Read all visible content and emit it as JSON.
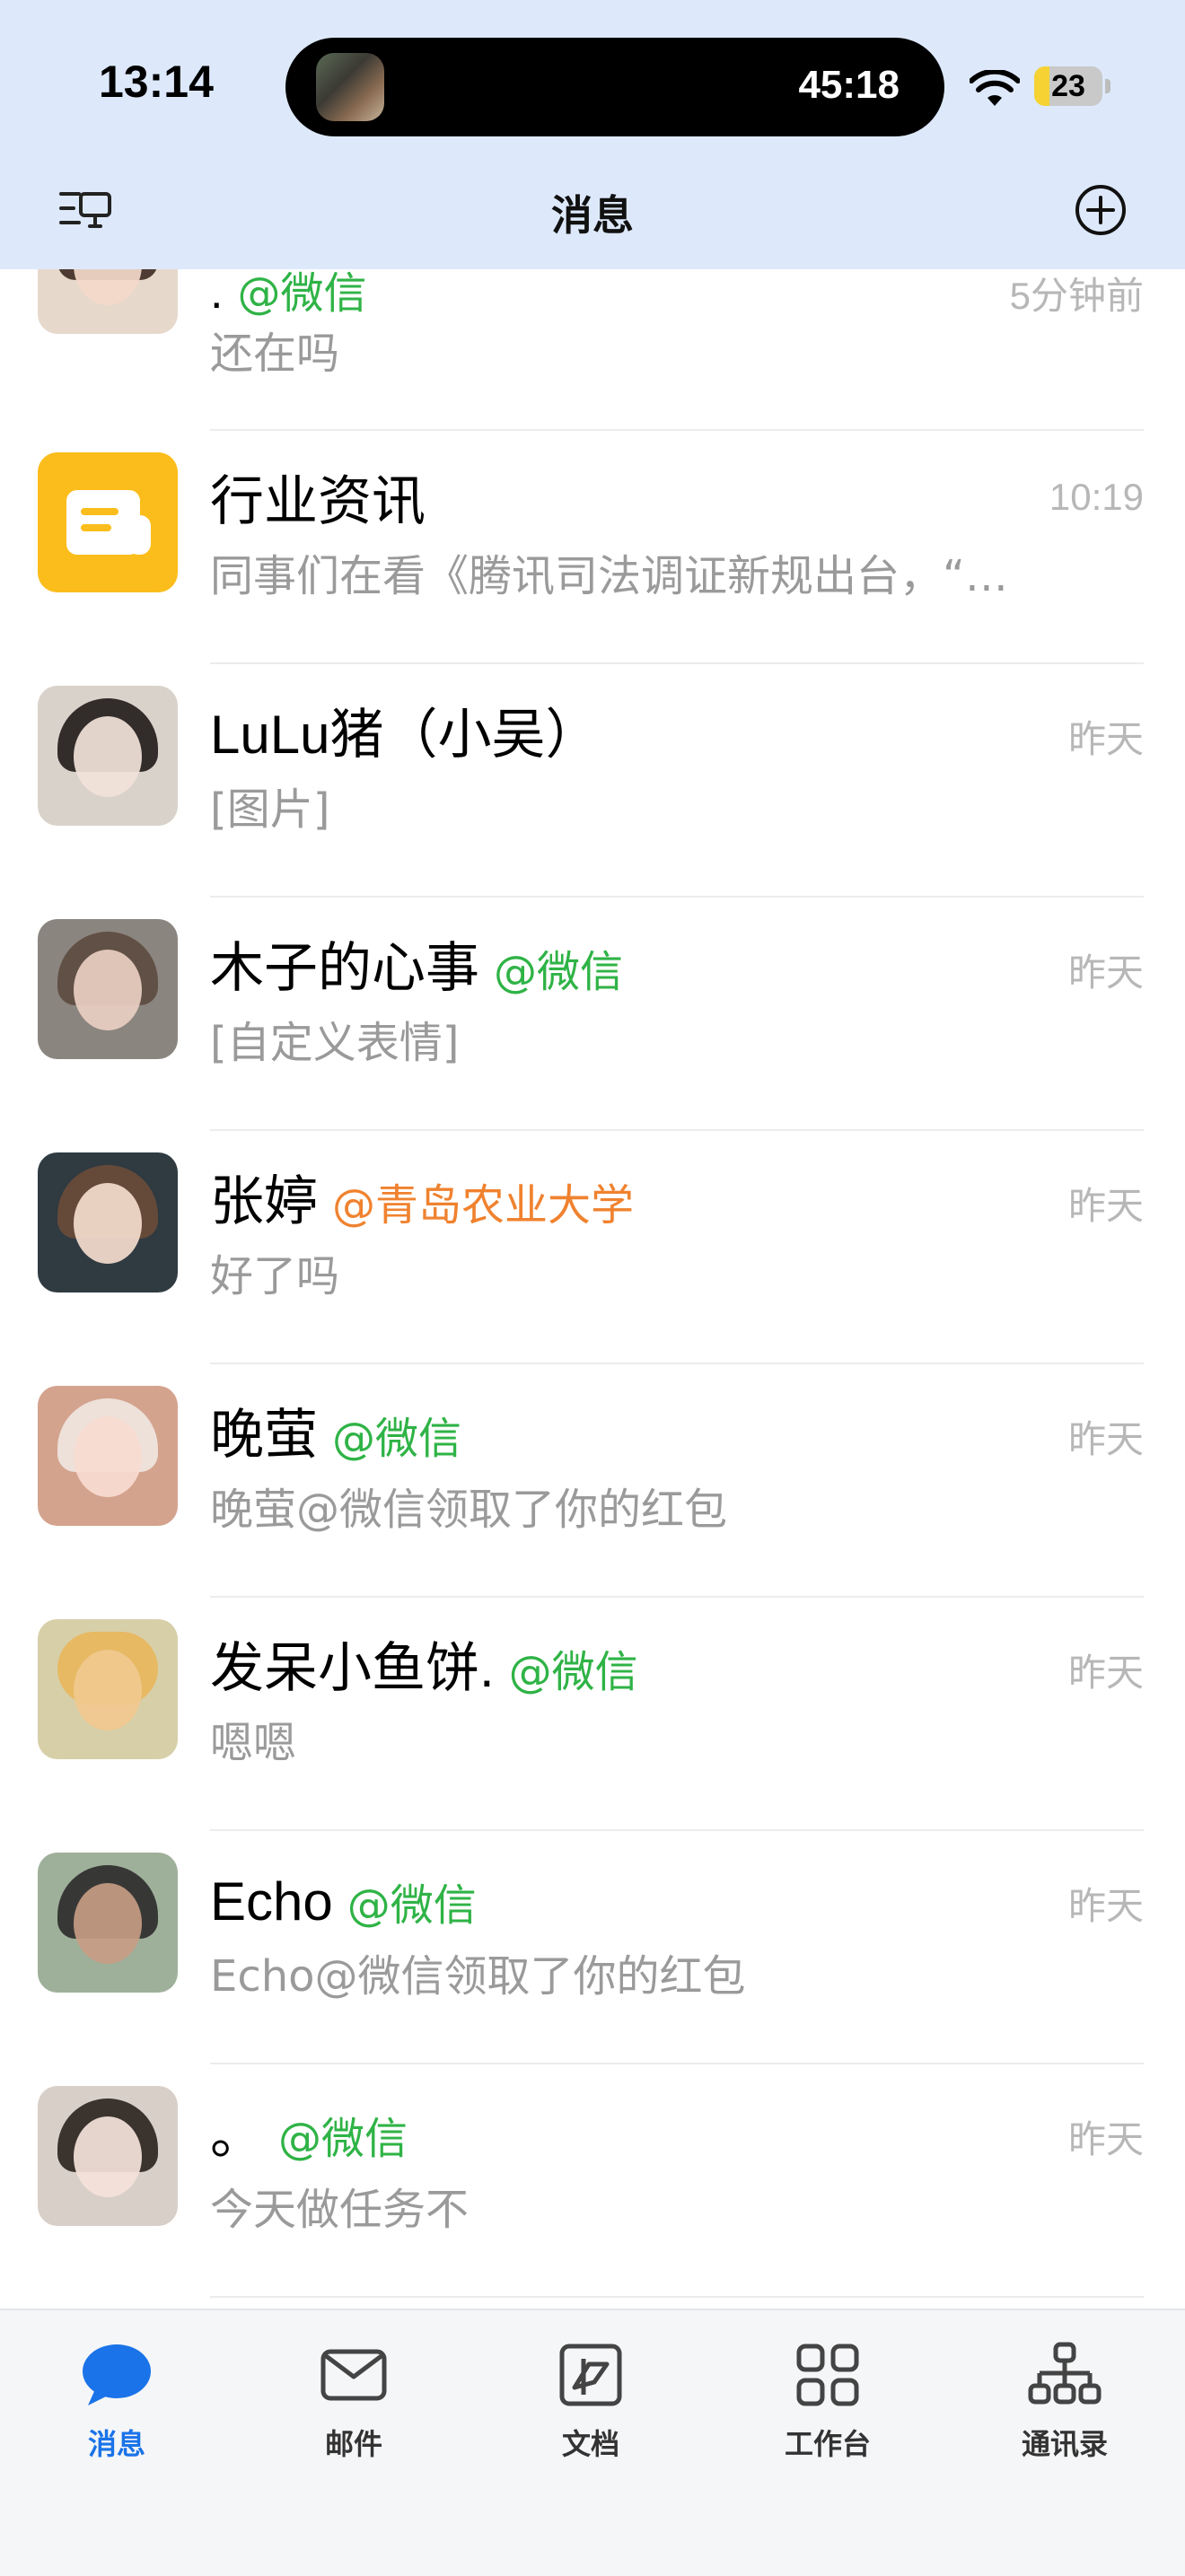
{
  "status_bar": {
    "time": "13:14",
    "activity_timer": "45:18",
    "battery": "23",
    "battery_level": 0.23
  },
  "header": {
    "title": "消息"
  },
  "conversations": [
    {
      "name": ".",
      "tag": "@微信",
      "tag_color": "#2fb346",
      "preview": "还在吗",
      "time": "5分钟前"
    },
    {
      "name": "行业资讯",
      "tag": "",
      "tag_color": "",
      "preview": "同事们在看《腾讯司法调证新规出台，“…",
      "time": "10:19"
    },
    {
      "name": "LuLu猪（小吴）",
      "tag": "",
      "tag_color": "",
      "preview": "[图片]",
      "time": "昨天"
    },
    {
      "name": "木子的心事",
      "tag": "@微信",
      "tag_color": "#2fb346",
      "preview": "[自定义表情]",
      "time": "昨天"
    },
    {
      "name": "张婷",
      "tag": "@青岛农业大学",
      "tag_color": "#f0822f",
      "preview": "好了吗",
      "time": "昨天"
    },
    {
      "name": "晚萤",
      "tag": "@微信",
      "tag_color": "#2fb346",
      "preview": "晚萤@微信领取了你的红包",
      "time": "昨天"
    },
    {
      "name": "发呆小鱼饼.",
      "tag": "@微信",
      "tag_color": "#2fb346",
      "preview": "嗯嗯",
      "time": "昨天"
    },
    {
      "name": "Echo",
      "tag": "@微信",
      "tag_color": "#2fb346",
      "preview": "Echo@微信领取了你的红包",
      "time": "昨天"
    },
    {
      "name": "。",
      "tag": "@微信",
      "tag_color": "#2fb346",
      "preview": "今天做任务不",
      "time": "昨天"
    }
  ],
  "tabbar": {
    "items": [
      {
        "label": "消息",
        "icon": "chat-bubble-icon",
        "active": true
      },
      {
        "label": "邮件",
        "icon": "mail-icon",
        "active": false
      },
      {
        "label": "文档",
        "icon": "document-icon",
        "active": false
      },
      {
        "label": "工作台",
        "icon": "grid-icon",
        "active": false
      },
      {
        "label": "通讯录",
        "icon": "org-chart-icon",
        "active": false
      }
    ]
  },
  "colors": {
    "header_bg": "#dde9fb",
    "accent_blue": "#1a73e8",
    "wechat_green": "#2fb346",
    "org_orange": "#f0822f"
  }
}
